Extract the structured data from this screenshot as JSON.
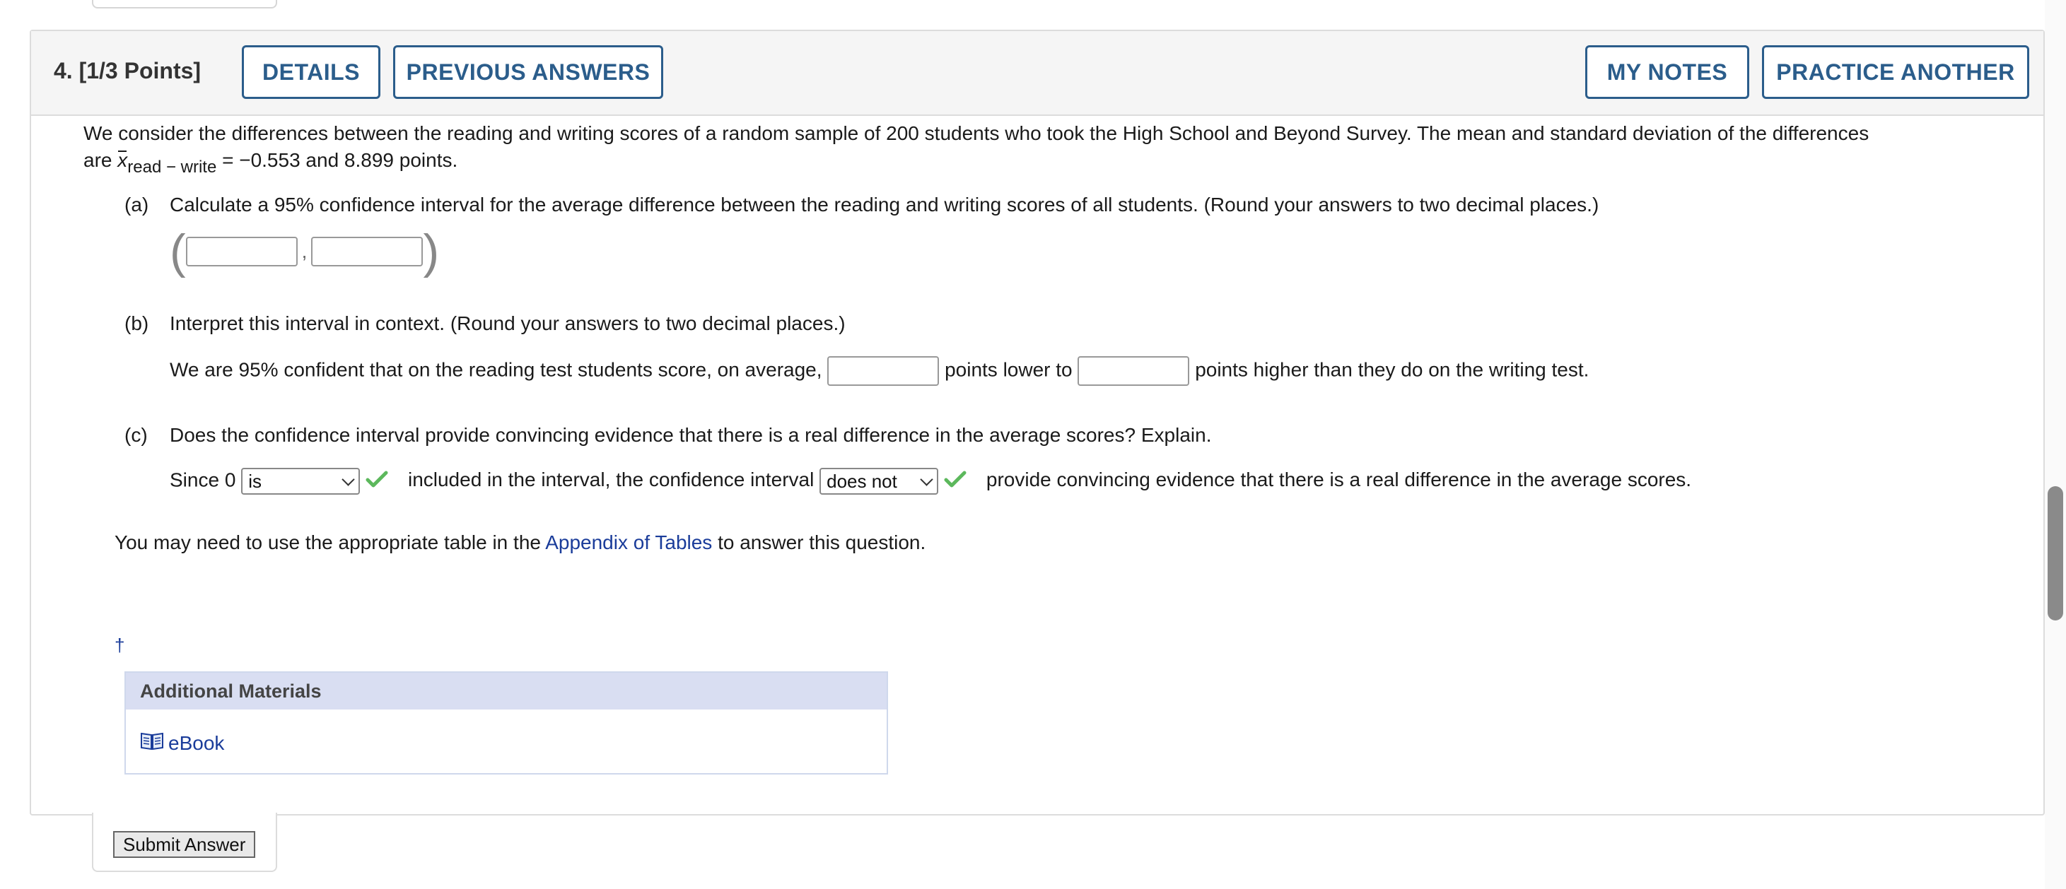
{
  "question": {
    "number_label": "4.",
    "points_label": "[1/3 Points]",
    "buttons": {
      "details": "DETAILS",
      "previous_answers": "PREVIOUS ANSWERS",
      "my_notes": "MY NOTES",
      "practice_another": "PRACTICE ANOTHER"
    },
    "intro_line1": "We consider the differences between the reading and writing scores of a random sample of 200 students who took the High School and Beyond Survey. The mean and standard deviation of the differences",
    "intro_are": "are ",
    "intro_x": "x",
    "intro_subscript": "read − write",
    "intro_tail": " = −0.553 and 8.899 points.",
    "parts": {
      "a": {
        "label": "(a)",
        "text": "Calculate a 95% confidence interval for the average difference between the reading and writing scores of all students. (Round your answers to two decimal places.)",
        "open_paren": "(",
        "comma": ",",
        "close_paren": ")",
        "lower_value": "",
        "upper_value": ""
      },
      "b": {
        "label": "(b)",
        "text": "Interpret this interval in context. (Round your answers to two decimal places.)",
        "sentence_start": "We are 95% confident that on the reading test students score, on average,",
        "sentence_mid": "points lower to",
        "sentence_end": "points higher than they do on the writing test.",
        "lower_value": "",
        "higher_value": ""
      },
      "c": {
        "label": "(c)",
        "text": "Does the confidence interval provide convincing evidence that there is a real difference in the average scores? Explain.",
        "since": "Since 0",
        "select1_value": "is",
        "mid": "included in the interval, the confidence interval",
        "select2_value": "does not",
        "end": "provide convincing evidence that there is a real difference in the average scores."
      }
    },
    "appendix_prefix": "You may need to use the appropriate table in the ",
    "appendix_link": "Appendix of Tables",
    "appendix_suffix": " to answer this question.",
    "dagger": "†",
    "additional_materials": {
      "title": "Additional Materials",
      "ebook_label": "eBook"
    },
    "submit_label": "Submit Answer"
  },
  "colors": {
    "button_blue": "#2b5d8b",
    "link_blue": "#1a3c9a",
    "check_green": "#5cb85c",
    "materials_header": "#d9def2"
  }
}
